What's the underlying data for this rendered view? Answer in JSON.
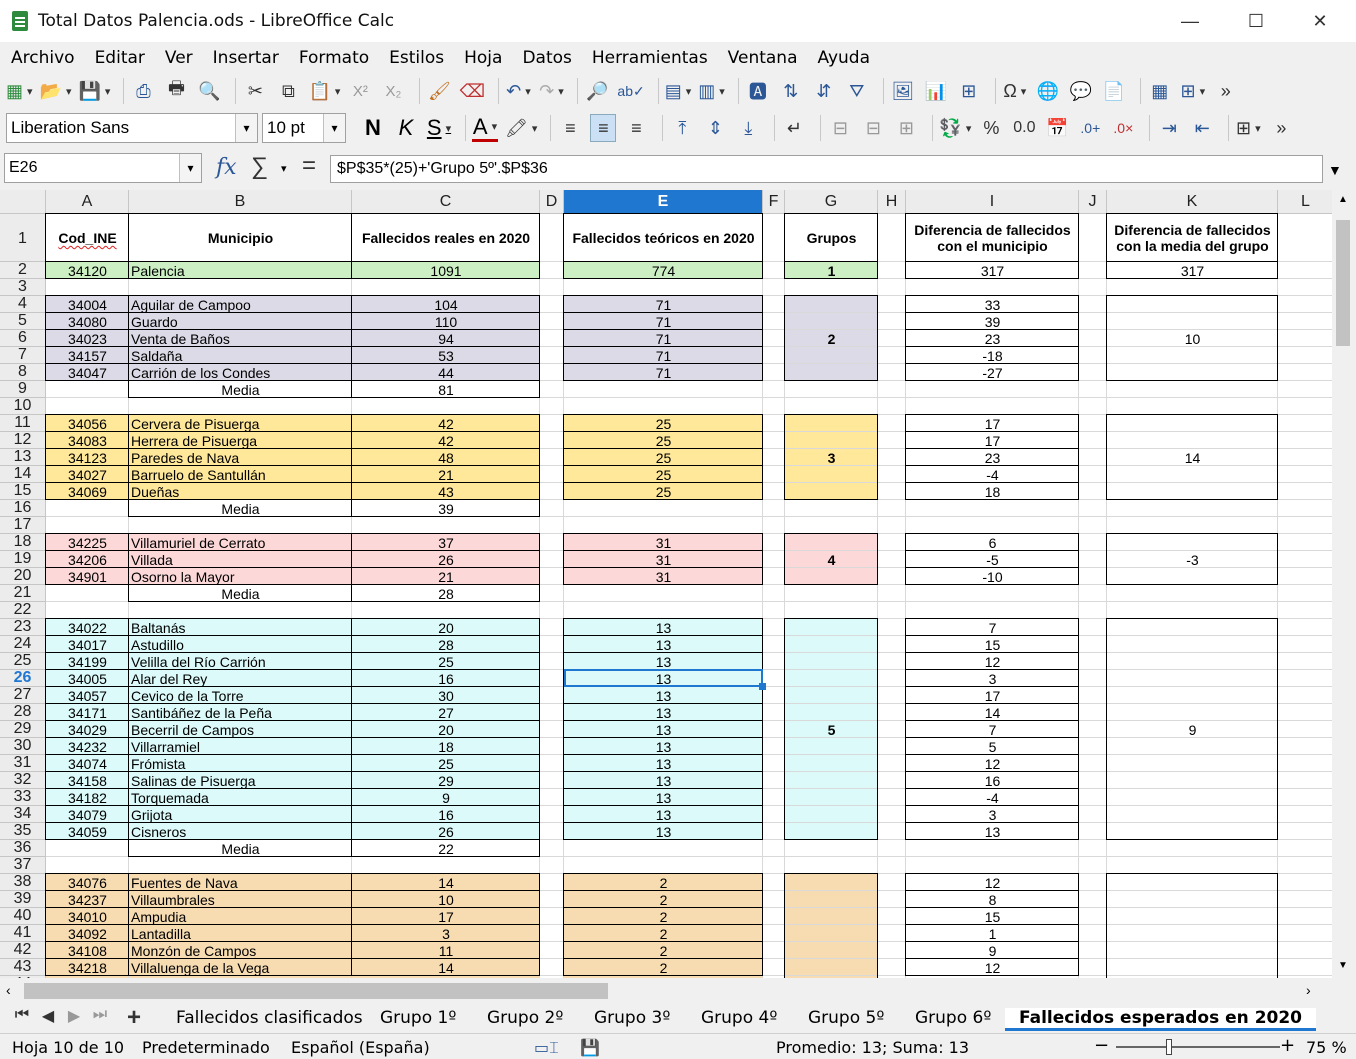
{
  "window": {
    "title": "Total Datos Palencia.ods - LibreOffice Calc",
    "minimize": "—",
    "maximize": "☐",
    "close": "✕"
  },
  "menu": [
    "Archivo",
    "Editar",
    "Ver",
    "Insertar",
    "Formato",
    "Estilos",
    "Hoja",
    "Datos",
    "Herramientas",
    "Ventana",
    "Ayuda"
  ],
  "font": {
    "name": "Liberation Sans",
    "size": "10 pt"
  },
  "formula_bar": {
    "cell_ref": "E26",
    "formula": "$P$35*(25)+'Grupo 5º'.$P$36"
  },
  "columns": [
    "A",
    "B",
    "C",
    "D",
    "E",
    "F",
    "G",
    "H",
    "I",
    "J",
    "K",
    "L"
  ],
  "selected_column": "E",
  "selected_row": "26",
  "headers": {
    "a": "Cod_INE",
    "b": "Municipio",
    "c": "Fallecidos reales en 2020",
    "e": "Fallecidos teóricos en 2020",
    "g": "Grupos",
    "i": "Diferencia de fallecidos con el municipio",
    "k": "Diferencia de fallecidos con la media del grupo"
  },
  "media_label": "Media",
  "rows": [
    {
      "r": 2,
      "a": "34120",
      "b": "Palencia",
      "c": "1091",
      "e": "774",
      "i": "317"
    },
    {
      "r": 4,
      "a": "34004",
      "b": "Aguilar de Campoo",
      "c": "104",
      "e": "71",
      "i": "33"
    },
    {
      "r": 5,
      "a": "34080",
      "b": "Guardo",
      "c": "110",
      "e": "71",
      "i": "39"
    },
    {
      "r": 6,
      "a": "34023",
      "b": "Venta de Baños",
      "c": "94",
      "e": "71",
      "i": "23"
    },
    {
      "r": 7,
      "a": "34157",
      "b": "Saldaña",
      "c": "53",
      "e": "71",
      "i": "-18"
    },
    {
      "r": 8,
      "a": "34047",
      "b": "Carrión de los Condes",
      "c": "44",
      "e": "71",
      "i": "-27"
    },
    {
      "r": 9,
      "media": "81"
    },
    {
      "r": 11,
      "a": "34056",
      "b": "Cervera de Pisuerga",
      "c": "42",
      "e": "25",
      "i": "17"
    },
    {
      "r": 12,
      "a": "34083",
      "b": "Herrera de Pisuerga",
      "c": "42",
      "e": "25",
      "i": "17"
    },
    {
      "r": 13,
      "a": "34123",
      "b": "Paredes de Nava",
      "c": "48",
      "e": "25",
      "i": "23"
    },
    {
      "r": 14,
      "a": "34027",
      "b": "Barruelo de Santullán",
      "c": "21",
      "e": "25",
      "i": "-4"
    },
    {
      "r": 15,
      "a": "34069",
      "b": "Dueñas",
      "c": "43",
      "e": "25",
      "i": "18"
    },
    {
      "r": 16,
      "media": "39"
    },
    {
      "r": 18,
      "a": "34225",
      "b": "Villamuriel de Cerrato",
      "c": "37",
      "e": "31",
      "i": "6"
    },
    {
      "r": 19,
      "a": "34206",
      "b": "Villada",
      "c": "26",
      "e": "31",
      "i": "-5"
    },
    {
      "r": 20,
      "a": "34901",
      "b": "Osorno la Mayor",
      "c": "21",
      "e": "31",
      "i": "-10"
    },
    {
      "r": 21,
      "media": "28"
    },
    {
      "r": 23,
      "a": "34022",
      "b": "Baltanás",
      "c": "20",
      "e": "13",
      "i": "7"
    },
    {
      "r": 24,
      "a": "34017",
      "b": "Astudillo",
      "c": "28",
      "e": "13",
      "i": "15"
    },
    {
      "r": 25,
      "a": "34199",
      "b": "Velilla del Río Carrión",
      "c": "25",
      "e": "13",
      "i": "12"
    },
    {
      "r": 26,
      "a": "34005",
      "b": "Alar del Rey",
      "c": "16",
      "e": "13",
      "i": "3"
    },
    {
      "r": 27,
      "a": "34057",
      "b": "Cevico de la Torre",
      "c": "30",
      "e": "13",
      "i": "17"
    },
    {
      "r": 28,
      "a": "34171",
      "b": "Santibáñez de la Peña",
      "c": "27",
      "e": "13",
      "i": "14"
    },
    {
      "r": 29,
      "a": "34029",
      "b": "Becerril de Campos",
      "c": "20",
      "e": "13",
      "i": "7"
    },
    {
      "r": 30,
      "a": "34232",
      "b": "Villarramiel",
      "c": "18",
      "e": "13",
      "i": "5"
    },
    {
      "r": 31,
      "a": "34074",
      "b": "Frómista",
      "c": "25",
      "e": "13",
      "i": "12"
    },
    {
      "r": 32,
      "a": "34158",
      "b": "Salinas de Pisuerga",
      "c": "29",
      "e": "13",
      "i": "16"
    },
    {
      "r": 33,
      "a": "34182",
      "b": "Torquemada",
      "c": "9",
      "e": "13",
      "i": "-4"
    },
    {
      "r": 34,
      "a": "34079",
      "b": "Grijota",
      "c": "16",
      "e": "13",
      "i": "3"
    },
    {
      "r": 35,
      "a": "34059",
      "b": "Cisneros",
      "c": "26",
      "e": "13",
      "i": "13"
    },
    {
      "r": 36,
      "media": "22"
    },
    {
      "r": 38,
      "a": "34076",
      "b": "Fuentes de Nava",
      "c": "14",
      "e": "2",
      "i": "12"
    },
    {
      "r": 39,
      "a": "34237",
      "b": "Villaumbrales",
      "c": "10",
      "e": "2",
      "i": "8"
    },
    {
      "r": 40,
      "a": "34010",
      "b": "Ampudia",
      "c": "17",
      "e": "2",
      "i": "15"
    },
    {
      "r": 41,
      "a": "34092",
      "b": "Lantadilla",
      "c": "3",
      "e": "2",
      "i": "1"
    },
    {
      "r": 42,
      "a": "34108",
      "b": "Monzón de Campos",
      "c": "11",
      "e": "2",
      "i": "9"
    },
    {
      "r": 43,
      "a": "34218",
      "b": "Villaluenga de la Vega",
      "c": "14",
      "e": "2",
      "i": "12"
    }
  ],
  "groups": [
    {
      "from": 2,
      "to": 2,
      "g": "1",
      "k": "317",
      "color": "#ccf0c4"
    },
    {
      "from": 4,
      "to": 8,
      "g": "2",
      "k": "10",
      "color": "#dcdae6"
    },
    {
      "from": 11,
      "to": 15,
      "g": "3",
      "k": "14",
      "color": "#ffe89a"
    },
    {
      "from": 18,
      "to": 20,
      "g": "4",
      "k": "-3",
      "color": "#fcd8d8"
    },
    {
      "from": 23,
      "to": 35,
      "g": "5",
      "k": "9",
      "color": "#dcfafa"
    },
    {
      "from": 38,
      "to": 44,
      "g": "",
      "k": "",
      "color": "#f7dcb2"
    }
  ],
  "sheet_tabs": [
    "Fallecidos clasificados",
    "Grupo 1º",
    "Grupo 2º",
    "Grupo 3º",
    "Grupo 4º",
    "Grupo 5º",
    "Grupo 6º",
    "Fallecidos esperados en 2020"
  ],
  "active_tab": "Fallecidos esperados en 2020",
  "status": {
    "sheet": "Hoja 10 de 10",
    "style": "Predeterminado",
    "language": "Español (España)",
    "stats": "Promedio: 13; Suma: 13",
    "zoom": "75 %"
  }
}
